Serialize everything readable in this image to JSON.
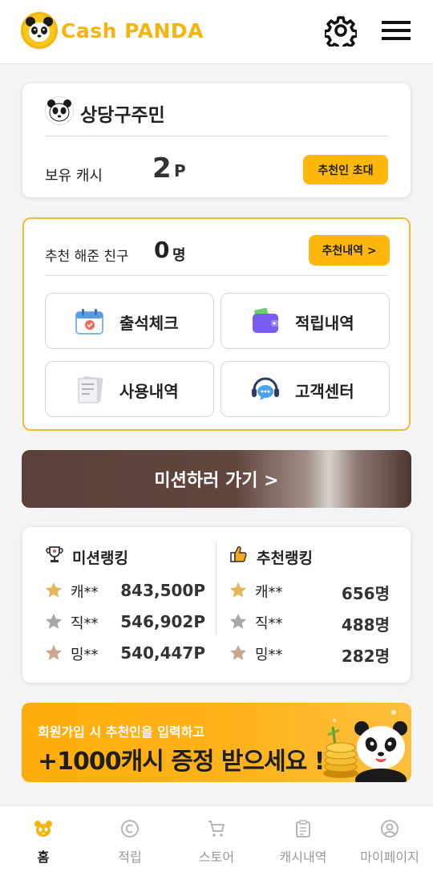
{
  "header": {
    "logo_text_1": "Cash",
    "logo_text_2": "PANDA",
    "settings_icon": "gear-icon",
    "menu_icon": "hamburger-menu-icon"
  },
  "profile": {
    "name": "상당구주민",
    "cash_label": "보유 캐시",
    "cash_value": "2",
    "cash_unit": "P",
    "invite_label": "추천인 초대"
  },
  "friends": {
    "label": "추천 해준 친구",
    "count": "0",
    "count_unit": "명",
    "history_label": "추천내역 >",
    "tiles": [
      {
        "label": "출석체크",
        "icon": "calendar-icon"
      },
      {
        "label": "적립내역",
        "icon": "wallet-icon"
      },
      {
        "label": "사용내역",
        "icon": "receipt-icon"
      },
      {
        "label": "고객센터",
        "icon": "headset-chat-icon"
      }
    ]
  },
  "mission": {
    "label": "미션하러 가기 >"
  },
  "ranking": {
    "mission": {
      "title": "미션랭킹",
      "rows": [
        {
          "name": "캐**",
          "value": "843,500P"
        },
        {
          "name": "직**",
          "value": "546,902P"
        },
        {
          "name": "밍**",
          "value": "540,447P"
        }
      ]
    },
    "referral": {
      "title": "추천랭킹",
      "rows": [
        {
          "name": "캐**",
          "value": "656명"
        },
        {
          "name": "직**",
          "value": "488명"
        },
        {
          "name": "밍**",
          "value": "282명"
        }
      ]
    },
    "star_colors": [
      "#e1b75a",
      "#a9a9a9",
      "#c9a88f"
    ]
  },
  "banner": {
    "line1": "회원가입 시 추천인을 입력하고",
    "line2": "+1000캐시 증정 받으세요 !"
  },
  "nav": {
    "items": [
      {
        "label": "홈",
        "icon": "home-panda-icon"
      },
      {
        "label": "적립",
        "icon": "coin-c-icon"
      },
      {
        "label": "스토어",
        "icon": "cart-icon"
      },
      {
        "label": "캐시내역",
        "icon": "clipboard-icon"
      },
      {
        "label": "마이페이지",
        "icon": "user-circle-icon"
      }
    ]
  },
  "colors": {
    "brand_yellow": "#ffb70c",
    "logo_yellow": "#f6b50d",
    "banner_orange": "#ffad0a",
    "mission_brown": "#5b3f38"
  }
}
